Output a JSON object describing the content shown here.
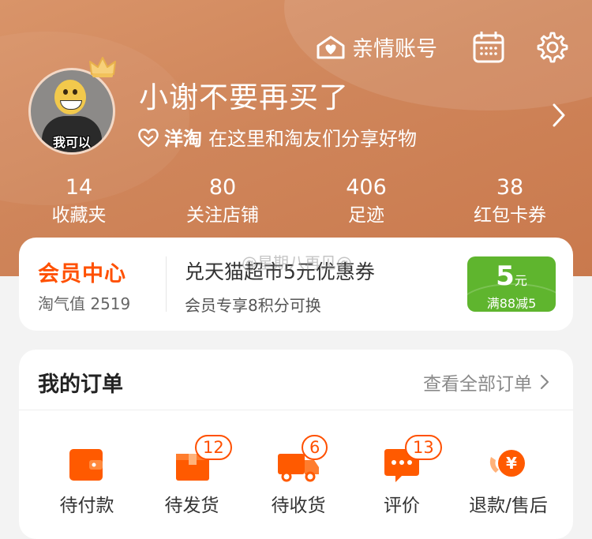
{
  "header": {
    "family_account_label": "亲情账号",
    "user_name": "小谢不要再买了",
    "avatar_caption": "我可以",
    "slogan_brand": "洋淘",
    "slogan_text": "在这里和淘友们分享好物"
  },
  "stats": [
    {
      "value": "14",
      "label": "收藏夹"
    },
    {
      "value": "80",
      "label": "关注店铺"
    },
    {
      "value": "406",
      "label": "足迹"
    },
    {
      "value": "38",
      "label": "红包卡券"
    }
  ],
  "member": {
    "title": "会员中心",
    "value_text": "淘气值 2519",
    "coupon_title": "兑天猫超市5元优惠券",
    "coupon_sub": "会员专享8积分可换",
    "badge_amount": "5",
    "badge_unit": "元",
    "badge_rule": "满88减5",
    "watermark": "@星期八再见@"
  },
  "orders": {
    "title": "我的订单",
    "view_all": "查看全部订单",
    "items": [
      {
        "label": "待付款",
        "icon": "wallet-icon",
        "badge": ""
      },
      {
        "label": "待发货",
        "icon": "package-icon",
        "badge": "12"
      },
      {
        "label": "待收货",
        "icon": "truck-icon",
        "badge": "6"
      },
      {
        "label": "评价",
        "icon": "comment-icon",
        "badge": "13"
      },
      {
        "label": "退款/售后",
        "icon": "refund-icon",
        "badge": ""
      }
    ]
  },
  "colors": {
    "header_bg": "#cf855a",
    "accent": "#ff5000",
    "coupon_green": "#5fb52e"
  }
}
